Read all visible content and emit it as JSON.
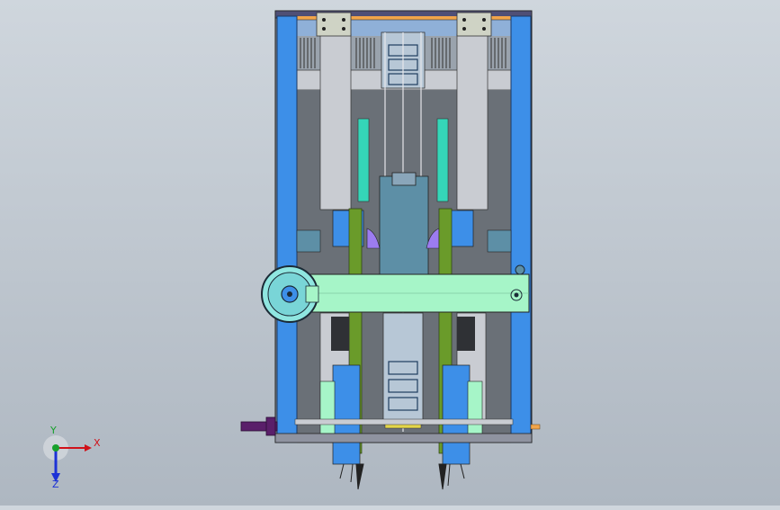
{
  "view": {
    "background_top": "#cfd6dd",
    "background_bottom": "#aeb7c1",
    "part_colors": {
      "frame_blue": "#3d8fe8",
      "mint": "#a6f5c8",
      "teal": "#35d6b8",
      "slate": "#5d8fa6",
      "light_gray": "#c9ccd2",
      "dark_gray": "#6a7077",
      "purple_handle": "#5a1f6a",
      "orange_strip": "#f2a54a",
      "yellow_spring": "#e4d64a",
      "violet_part": "#9c7cf0",
      "olive_rod": "#6a9b2a"
    }
  },
  "triad": {
    "x_label": "X",
    "y_label": "Y",
    "z_label": "Z",
    "x_color": "#d0121a",
    "y_color": "#18a02c",
    "z_color": "#1c32d6"
  }
}
